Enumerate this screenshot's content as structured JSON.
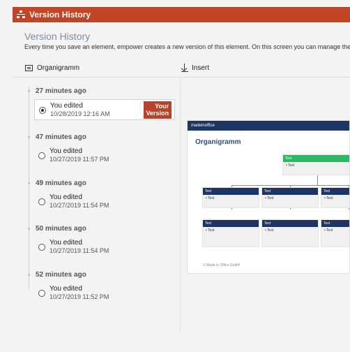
{
  "window": {
    "title": "Version History"
  },
  "header": {
    "title": "Version History",
    "description": "Every time you save an element, empower creates a new version of this element. On this screen you can manage these versio"
  },
  "columns": {
    "left_label": "Organigramm",
    "right_label": "Insert"
  },
  "versions": [
    {
      "time": "27 minutes ago",
      "action": "You edited",
      "date": "10/28/2019 12:16 AM",
      "selected": true,
      "badge_line1": "Your",
      "badge_line2": "Version"
    },
    {
      "time": "47 minutes ago",
      "action": "You edited",
      "date": "10/27/2019 11:57 PM",
      "selected": false
    },
    {
      "time": "49 minutes ago",
      "action": "You edited",
      "date": "10/27/2019 11:54 PM",
      "selected": false
    },
    {
      "time": "50 minutes ago",
      "action": "You edited",
      "date": "10/27/2019 11:54 PM",
      "selected": false
    },
    {
      "time": "52 minutes ago",
      "action": "You edited",
      "date": "10/27/2019 11:52 PM",
      "selected": false
    }
  ],
  "preview": {
    "logo": "madeinoffice",
    "title": "Organigramm",
    "top_box": {
      "header": "Text",
      "item": "• Text"
    },
    "boxes": [
      {
        "header": "Text",
        "item": "• Text"
      },
      {
        "header": "Text",
        "item": "• Text"
      },
      {
        "header": "Text",
        "item": "• Text"
      },
      {
        "header": "Text",
        "item": "• Text"
      },
      {
        "header": "Text",
        "item": "• Text"
      },
      {
        "header": "Text",
        "item": "• Text"
      }
    ],
    "footer": "© Made in Office GmbH"
  },
  "colors": {
    "titlebar": "#c04527",
    "badge": "#b8422a",
    "preview_header": "#1c3563",
    "preview_accent": "#2db865"
  }
}
